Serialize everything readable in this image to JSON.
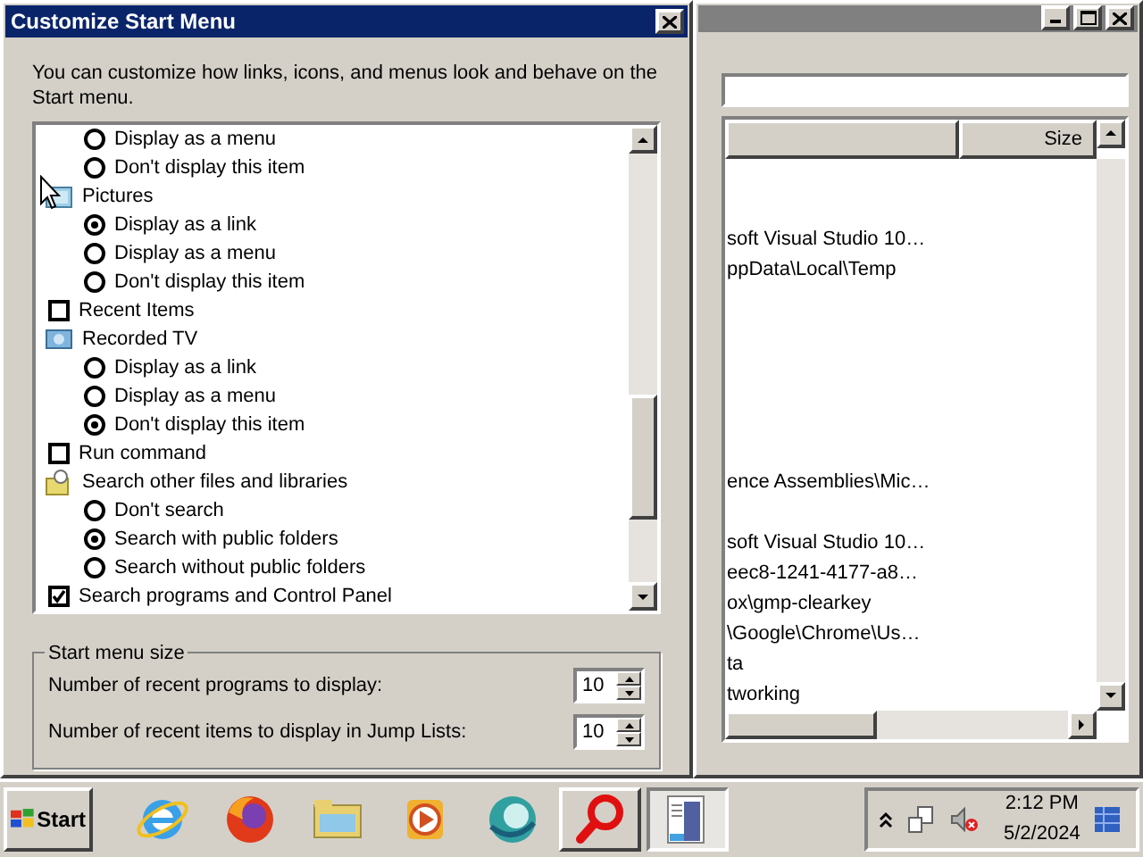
{
  "dialog": {
    "title": "Customize Start Menu",
    "description": "You can customize how links, icons, and menus look and behave on the Start menu.",
    "options": [
      {
        "kind": "radio",
        "label": "Display as a menu",
        "selected": false
      },
      {
        "kind": "radio",
        "label": "Don't display this item",
        "selected": false
      },
      {
        "kind": "header",
        "label": "Pictures"
      },
      {
        "kind": "radio",
        "label": "Display as a link",
        "selected": true
      },
      {
        "kind": "radio",
        "label": "Display as a menu",
        "selected": false
      },
      {
        "kind": "radio",
        "label": "Don't display this item",
        "selected": false
      },
      {
        "kind": "checkbox",
        "label": "Recent Items",
        "checked": false
      },
      {
        "kind": "header",
        "label": "Recorded TV"
      },
      {
        "kind": "radio",
        "label": "Display as a link",
        "selected": false
      },
      {
        "kind": "radio",
        "label": "Display as a menu",
        "selected": false
      },
      {
        "kind": "radio",
        "label": "Don't display this item",
        "selected": true
      },
      {
        "kind": "checkbox",
        "label": "Run command",
        "checked": false
      },
      {
        "kind": "header",
        "label": "Search other files and libraries"
      },
      {
        "kind": "radio",
        "label": "Don't search",
        "selected": false
      },
      {
        "kind": "radio",
        "label": "Search with public folders",
        "selected": true
      },
      {
        "kind": "radio",
        "label": "Search without public folders",
        "selected": false
      },
      {
        "kind": "checkbox",
        "label": "Search programs and Control Panel",
        "checked": true
      }
    ],
    "size_group": {
      "title": "Start menu size",
      "fields": [
        {
          "label": "Number of recent programs to display:",
          "value": "10"
        },
        {
          "label": "Number of recent items to display in Jump Lists:",
          "value": "10"
        }
      ]
    }
  },
  "background_window": {
    "columns": [
      {
        "kind": "blank"
      },
      {
        "kind": "text",
        "label": "Size"
      }
    ],
    "rows": [
      {
        "kind": "blank"
      },
      {
        "kind": "blank"
      },
      {
        "kind": "text",
        "text": "soft Visual Studio 10…"
      },
      {
        "kind": "text",
        "text": "ppData\\Local\\Temp"
      },
      {
        "kind": "blank"
      },
      {
        "kind": "blank"
      },
      {
        "kind": "blank"
      },
      {
        "kind": "blank"
      },
      {
        "kind": "blank"
      },
      {
        "kind": "blank"
      },
      {
        "kind": "text",
        "text": "ence Assemblies\\Mic…"
      },
      {
        "kind": "blank"
      },
      {
        "kind": "text",
        "text": "soft Visual Studio 10…"
      },
      {
        "kind": "text",
        "text": "eec8-1241-4177-a8…"
      },
      {
        "kind": "text",
        "text": "ox\\gmp-clearkey"
      },
      {
        "kind": "text",
        "text": "\\Google\\Chrome\\Us…"
      },
      {
        "kind": "text",
        "text": "ta"
      },
      {
        "kind": "text",
        "text": "tworking"
      }
    ]
  },
  "taskbar": {
    "start": "Start",
    "apps": [
      {
        "kind": "ie",
        "selected": false
      },
      {
        "kind": "firefox",
        "selected": false
      },
      {
        "kind": "explorer",
        "selected": false
      },
      {
        "kind": "media",
        "selected": false
      },
      {
        "kind": "globe",
        "selected": false
      },
      {
        "kind": "magnifier",
        "selected": false
      },
      {
        "kind": "document",
        "selected": true
      }
    ],
    "tray": {
      "time": "2:12 PM",
      "date": "5/2/2024"
    }
  }
}
